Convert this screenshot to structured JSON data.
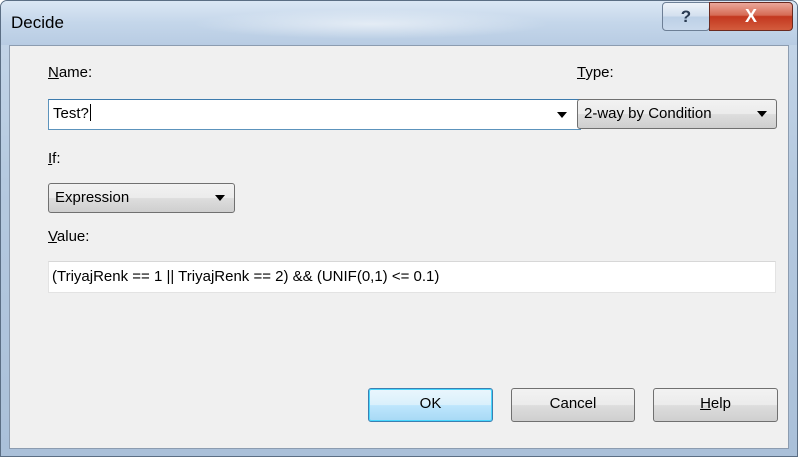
{
  "window": {
    "title": "Decide",
    "help_glyph": "?",
    "close_glyph": "X"
  },
  "form": {
    "name": {
      "label_accel": "N",
      "label_rest": "ame:",
      "value": "Test?"
    },
    "type": {
      "label_accel": "T",
      "label_rest": "ype:",
      "selected": "2-way by Condition"
    },
    "if": {
      "label_accel": "I",
      "label_rest": "f:",
      "selected": "Expression"
    },
    "value": {
      "label_accel": "V",
      "label_rest": "alue:",
      "expression": "(TriyajRenk == 1  || TriyajRenk == 2) && (UNIF(0,1) <= 0.1)"
    }
  },
  "buttons": {
    "ok": "OK",
    "cancel": "Cancel",
    "help_accel": "H",
    "help_rest": "elp"
  },
  "icons": {
    "dropdown": "chevron-down-icon",
    "help": "question-icon",
    "close": "close-icon"
  },
  "colors": {
    "close_button": "#c3371f",
    "default_button": "#bee6fd",
    "focused_field_border": "#3d7bad"
  }
}
